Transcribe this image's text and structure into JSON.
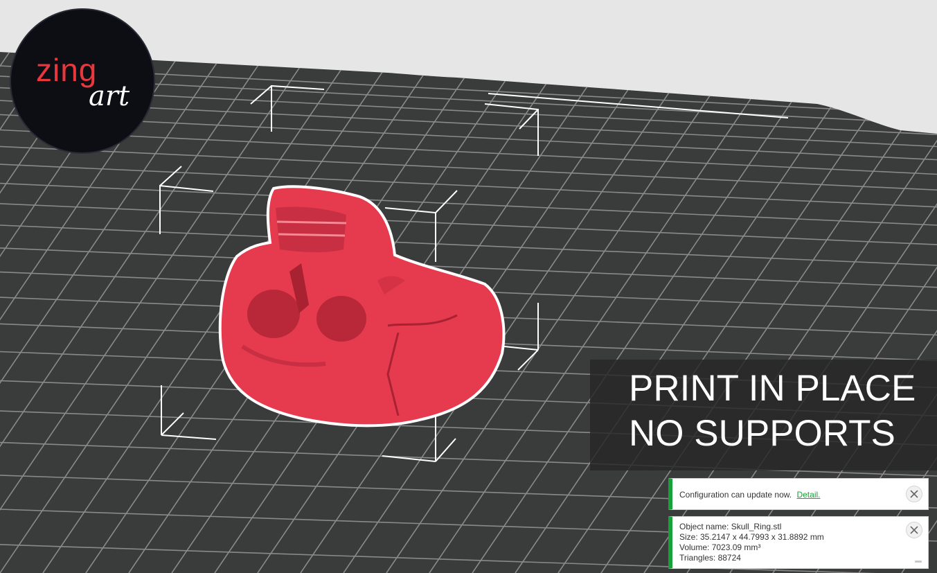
{
  "logo": {
    "text_primary": "zing",
    "text_secondary": "art"
  },
  "banner": {
    "line1": "PRINT IN PLACE",
    "line2": "NO SUPPORTS"
  },
  "notifications": {
    "config": {
      "message": "Configuration can update now.",
      "link": "Detail."
    },
    "object": {
      "name": "Object name: Skull_Ring.stl",
      "size": "Size: 35.2147 x 44.7993 x 31.8892 mm",
      "volume": "Volume: 7023.09 mm³",
      "triangles": "Triangles: 88724"
    }
  },
  "colors": {
    "plate": "#3a3b3b",
    "grid": "#8a8a8a",
    "model": "#e63a4e",
    "accent": "#1aa03a",
    "background": "#e6e6e6"
  },
  "icons": [
    "close-icon",
    "collapse-icon"
  ]
}
